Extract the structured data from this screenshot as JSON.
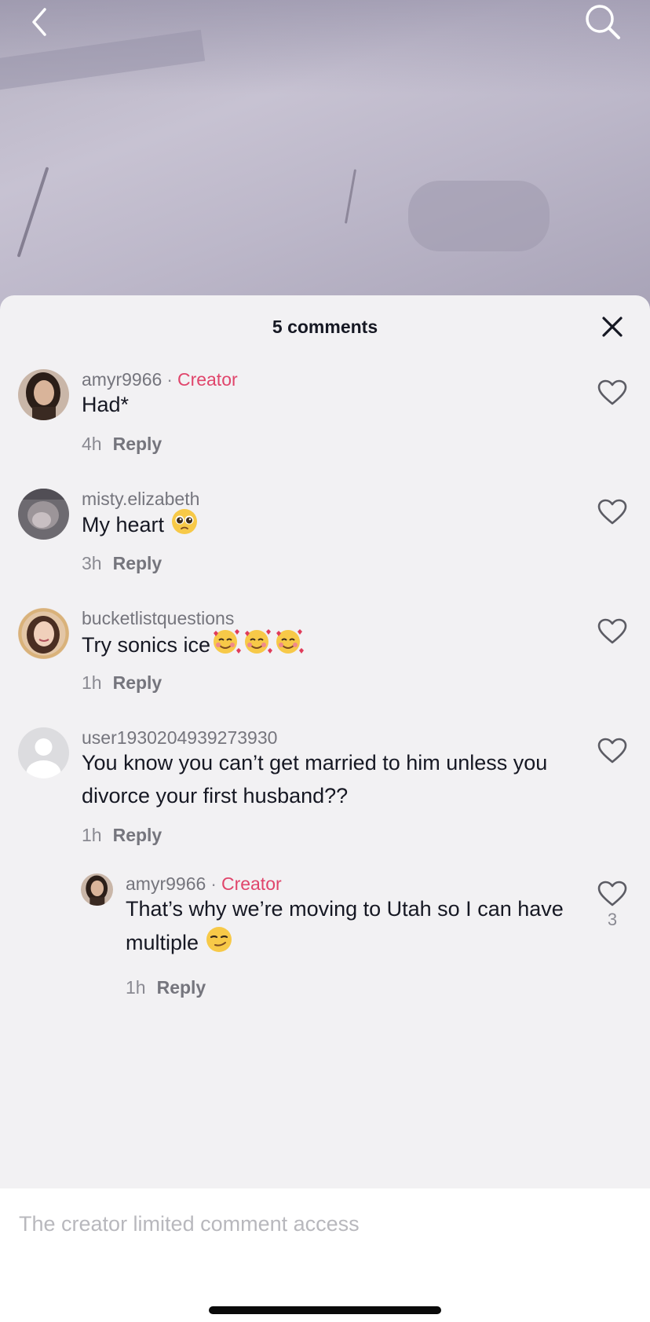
{
  "topbar": {
    "back_icon": "chevron-left-icon",
    "search_icon": "search-icon"
  },
  "sheet": {
    "title": "5 comments",
    "close_icon": "close-icon"
  },
  "comments": [
    {
      "username": "amyr9966",
      "badge": "Creator",
      "text": "Had*",
      "time": "4h",
      "reply": "Reply",
      "emoji": ""
    },
    {
      "username": "misty.elizabeth",
      "badge": "",
      "text": "My heart",
      "time": "3h",
      "reply": "Reply",
      "emoji": "pleading-face"
    },
    {
      "username": "bucketlistquestions",
      "badge": "",
      "text": "Try sonics ice",
      "time": "1h",
      "reply": "Reply",
      "emoji": "smiling-face-with-hearts x3"
    },
    {
      "username": "user1930204939273930",
      "badge": "",
      "text": "You know you can’t get married to him unless you divorce your first husband??",
      "time": "1h",
      "reply": "Reply",
      "emoji": ""
    }
  ],
  "reply_comment": {
    "username": "amyr9966",
    "badge": "Creator",
    "text": "That’s why we’re moving to Utah so I can have multiple",
    "time": "1h",
    "reply": "Reply",
    "likes": "3",
    "emoji": "smirking-face"
  },
  "footer": {
    "notice": "The creator limited comment access"
  },
  "colors": {
    "creator_badge": "#e0456b",
    "sheet_bg": "#f2f1f3",
    "text": "#161823",
    "muted": "#8a8a92"
  }
}
